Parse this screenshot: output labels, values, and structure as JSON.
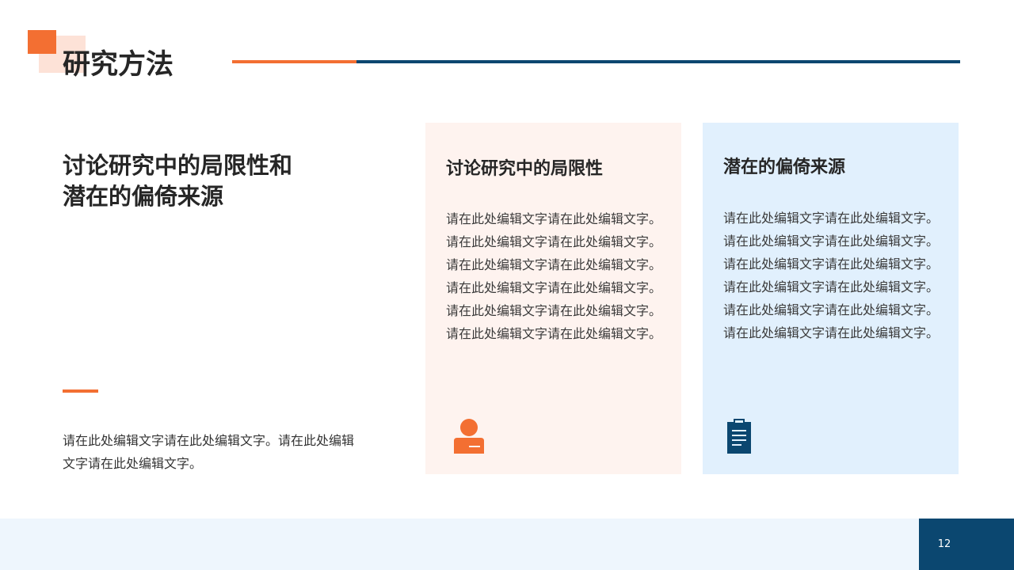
{
  "header": {
    "title": "研究方法"
  },
  "main": {
    "heading_line1": "讨论研究中的局限性和",
    "heading_line2": "潜在的偏倚来源",
    "body": "请在此处编辑文字请在此处编辑文字。请在此处编辑文字请在此处编辑文字。"
  },
  "cards": [
    {
      "title": "讨论研究中的局限性",
      "lines": [
        "请在此处编辑文字请在此处编辑文字。",
        "请在此处编辑文字请在此处编辑文字。",
        "请在此处编辑文字请在此处编辑文字。",
        "请在此处编辑文字请在此处编辑文字。",
        "请在此处编辑文字请在此处编辑文字。",
        "请在此处编辑文字请在此处编辑文字。"
      ],
      "icon": "person-icon"
    },
    {
      "title": "潜在的偏倚来源",
      "lines": [
        "请在此处编辑文字请在此处编辑文字。",
        "请在此处编辑文字请在此处编辑文字。",
        "请在此处编辑文字请在此处编辑文字。",
        "请在此处编辑文字请在此处编辑文字。",
        "请在此处编辑文字请在此处编辑文字。",
        "请在此处编辑文字请在此处编辑文字。"
      ],
      "icon": "clipboard-icon"
    }
  ],
  "footer": {
    "page_number": "12"
  },
  "colors": {
    "accent_orange": "#F36F32",
    "accent_navy": "#0B4770",
    "card_pink": "#FEF3EF",
    "card_blue": "#E1F0FD"
  }
}
